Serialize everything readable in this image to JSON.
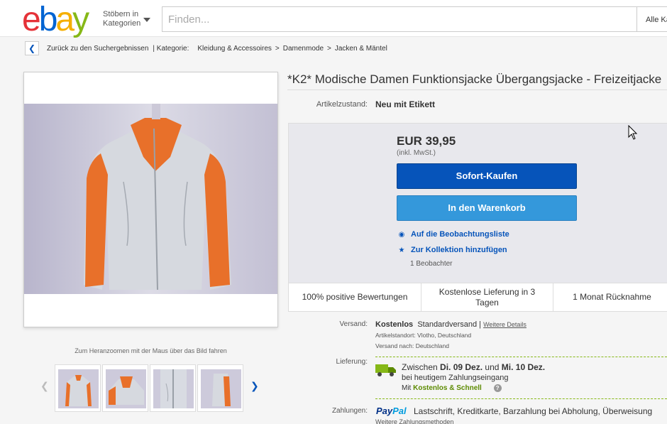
{
  "header": {
    "logo_letters": [
      "e",
      "b",
      "a",
      "y"
    ],
    "browse_line1": "Stöbern in",
    "browse_line2": "Kategorien",
    "search_placeholder": "Finden...",
    "category_select": "Alle Kategorien"
  },
  "breadcrumb": {
    "back": "Zurück zu den Suchergebnissen",
    "category_label": "| Kategorie:",
    "items": [
      "Kleidung & Accessoires",
      "Damenmode",
      "Jacken & Mäntel"
    ],
    "separator": ">"
  },
  "gallery": {
    "zoom_hint": "Zum Heranzoomen mit der Maus über das Bild fahren",
    "thumb_count": 4
  },
  "item": {
    "title": "*K2* Modische Damen Funktionsjacke Übergangsjacke - Freizeitjacke",
    "condition_label": "Artikelzustand:",
    "condition_value": "Neu mit Etikett"
  },
  "buybox": {
    "price": "EUR 39,95",
    "vat": "(inkl. MwSt.)",
    "buy_now": "Sofort-Kaufen",
    "add_to_cart": "In den Warenkorb",
    "watchlist": "Auf die Beobachtungsliste",
    "collection": "Zur Kollektion hinzufügen",
    "watchers": "1 Beobachter",
    "badges": [
      "100% positive Bewertungen",
      "Kostenlose Lieferung in 3 Tagen",
      "1 Monat Rücknahme"
    ]
  },
  "shipping": {
    "label": "Versand:",
    "cost": "Kostenlos",
    "method": "Standardversand |",
    "details_link": "Weitere Details",
    "location": "Artikelstandort: Vlotho, Deutschland",
    "ships_to": "Versand nach: Deutschland"
  },
  "delivery": {
    "label": "Lieferung:",
    "between": "Zwischen",
    "date1": "Di. 09 Dez.",
    "and": "und",
    "date2": "Mi. 10 Dez.",
    "condition": "bei heutigem Zahlungseingang",
    "with": "Mit",
    "service": "Kostenlos & Schnell",
    "help": "?"
  },
  "payment": {
    "label": "Zahlungen:",
    "paypal_1": "Pay",
    "paypal_2": "Pal",
    "methods": "Lastschrift, Kreditkarte, Barzahlung bei Abholung, Überweisung",
    "more": "Weitere Zahlungsmethoden"
  },
  "colors": {
    "buy_button": "#0654ba",
    "cart_button": "#3498db",
    "link": "#0654ba",
    "green": "#5c8a00"
  }
}
